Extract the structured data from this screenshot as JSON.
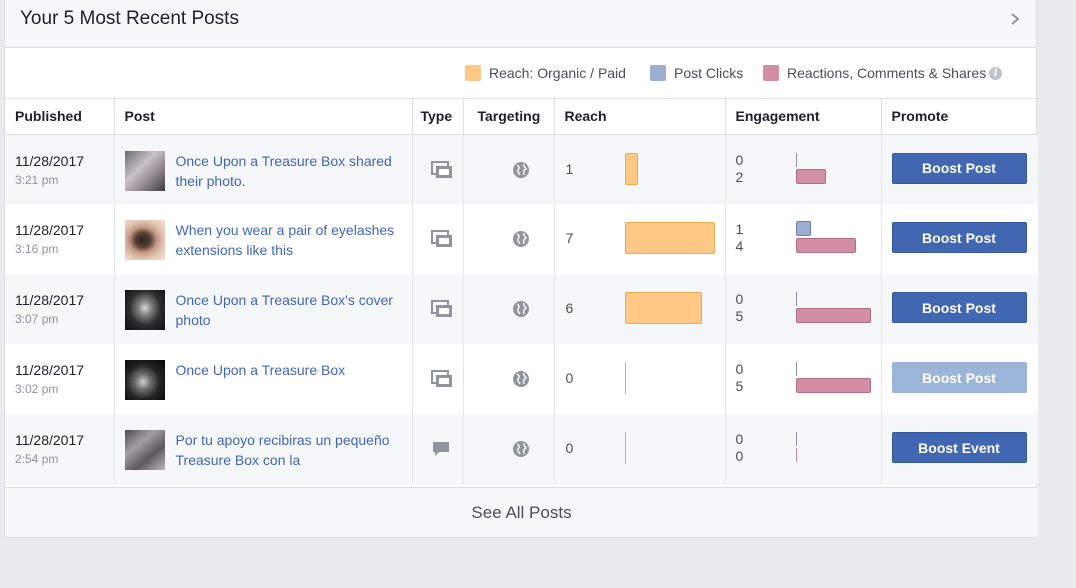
{
  "panel": {
    "title": "Your 5 Most Recent Posts",
    "chevron_icon": "chevron-right-icon"
  },
  "legend": {
    "items": [
      {
        "label": "Reach: Organic / Paid",
        "color": "#ffc985"
      },
      {
        "label": "Post Clicks",
        "color": "#9cadcf"
      },
      {
        "label": "Reactions, Comments & Shares",
        "color": "#d28ea3"
      }
    ],
    "info_icon": "info-icon",
    "info_glyph": "i"
  },
  "columns": [
    "Published",
    "Post",
    "Type",
    "Targeting",
    "Reach",
    "Engagement",
    "Promote"
  ],
  "rows": [
    {
      "date": "11/28/2017",
      "time": "3:21 pm",
      "post": "Once Upon a Treasure Box shared their photo.",
      "type_icon": "shared-photo-icon",
      "targeting_icon": "globe-icon",
      "reach": "1",
      "reach_fraction": 0.14,
      "post_clicks": "0",
      "reactions": "2",
      "clicks_fraction": 0,
      "reactions_fraction": 0.4,
      "promote": "Boost Post",
      "promote_disabled": false
    },
    {
      "date": "11/28/2017",
      "time": "3:16 pm",
      "post": "When you wear a pair of eyelashes extensions like this",
      "type_icon": "shared-photo-icon",
      "targeting_icon": "globe-icon",
      "reach": "7",
      "reach_fraction": 1.0,
      "post_clicks": "1",
      "reactions": "4",
      "clicks_fraction": 0.2,
      "reactions_fraction": 0.8,
      "promote": "Boost Post",
      "promote_disabled": false
    },
    {
      "date": "11/28/2017",
      "time": "3:07 pm",
      "post": "Once Upon a Treasure Box's cover photo",
      "type_icon": "shared-photo-icon",
      "targeting_icon": "globe-icon",
      "reach": "6",
      "reach_fraction": 0.86,
      "post_clicks": "0",
      "reactions": "5",
      "clicks_fraction": 0,
      "reactions_fraction": 1.0,
      "promote": "Boost Post",
      "promote_disabled": false
    },
    {
      "date": "11/28/2017",
      "time": "3:02 pm",
      "post": "Once Upon a Treasure Box",
      "type_icon": "shared-photo-icon",
      "targeting_icon": "globe-icon",
      "reach": "0",
      "reach_fraction": 0,
      "post_clicks": "0",
      "reactions": "5",
      "clicks_fraction": 0,
      "reactions_fraction": 1.0,
      "promote": "Boost Post",
      "promote_disabled": true
    },
    {
      "date": "11/28/2017",
      "time": "2:54 pm",
      "post": "Por tu apoyo recibiras un pequeño Treasure Box con la",
      "type_icon": "event-comment-icon",
      "targeting_icon": "globe-icon",
      "reach": "0",
      "reach_fraction": 0,
      "post_clicks": "0",
      "reactions": "0",
      "clicks_fraction": 0,
      "reactions_fraction": 0,
      "promote": "Boost Event",
      "promote_disabled": false
    }
  ],
  "footer": {
    "see_all": "See All Posts"
  }
}
